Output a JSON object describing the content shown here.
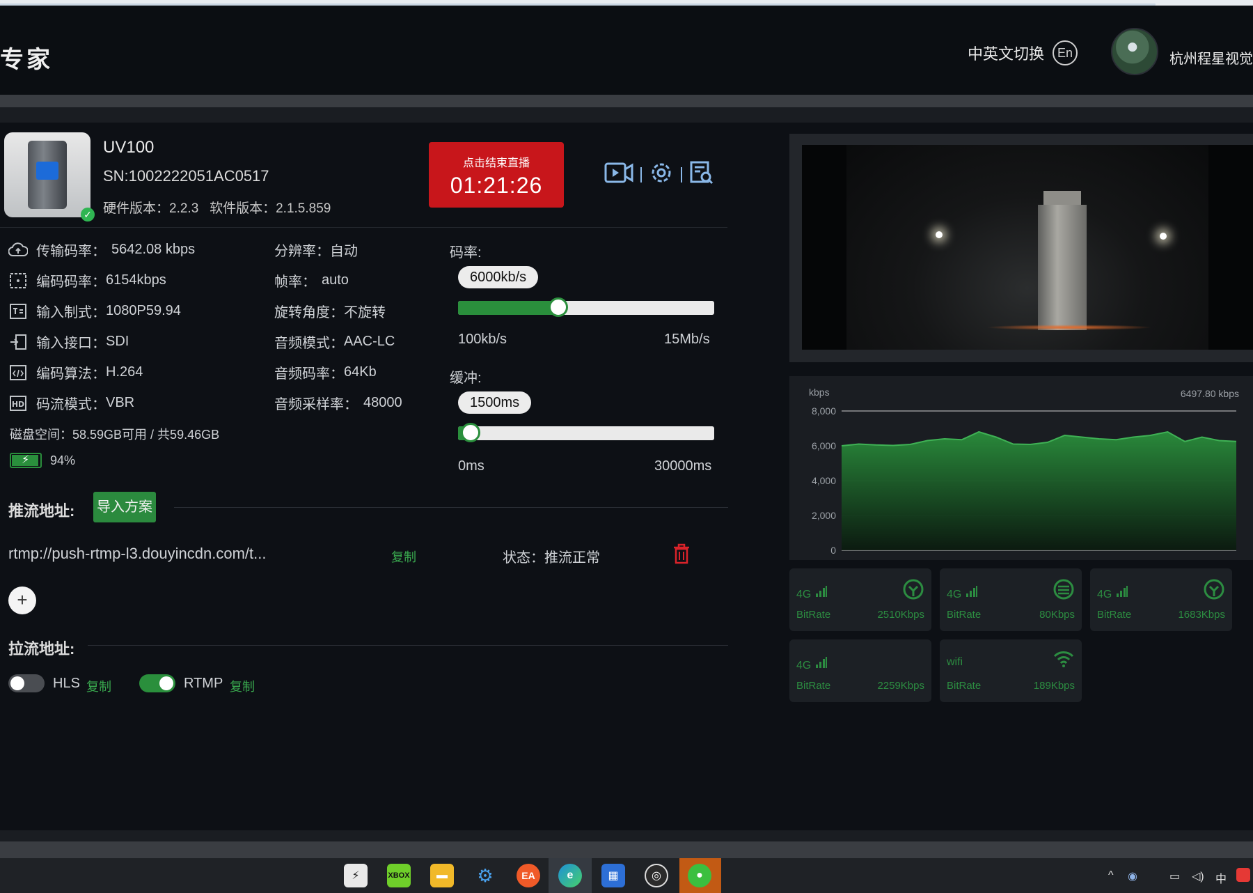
{
  "header": {
    "app_title": "专家",
    "lang_switch_label": "中英文切换",
    "lang_icon_text": "En",
    "company": "杭州程星视觉"
  },
  "device": {
    "name": "UV100",
    "sn": "SN:1002222051AC0517",
    "versions": "硬件版本：2.2.3   软件版本：2.1.5.859",
    "live_button_label": "点击结束直播",
    "live_timer": "01:21:26"
  },
  "info": {
    "col1": [
      {
        "icon": "cloud-upload-icon",
        "label": "传输码率：",
        "value": "5642.08 kbps"
      },
      {
        "icon": "encode-bitrate-icon",
        "label": "编码码率：",
        "value": "6154kbps"
      },
      {
        "icon": "input-format-icon",
        "label": "输入制式：",
        "value": "1080P59.94"
      },
      {
        "icon": "input-port-icon",
        "label": "输入接口：",
        "value": "SDI"
      },
      {
        "icon": "codec-icon",
        "label": "编码算法：",
        "value": "H.264"
      },
      {
        "icon": "hd-icon",
        "label": "码流模式：",
        "value": "VBR"
      }
    ],
    "col2": [
      {
        "label": "分辨率：",
        "value": "自动"
      },
      {
        "label": "帧率：",
        "value": "auto"
      },
      {
        "label": "旋转角度：",
        "value": "不旋转"
      },
      {
        "label": "音频模式：",
        "value": "AAC-LC"
      },
      {
        "label": "音频码率：",
        "value": "64Kb"
      },
      {
        "label": "音频采样率：",
        "value": "48000"
      }
    ],
    "disk": "磁盘空间：58.59GB可用 / 共59.46GB",
    "battery": "94%",
    "battery_level": 0.94
  },
  "bitrate_slider": {
    "label": "码率:",
    "value_label": "6000kb/s",
    "min_label": "100kb/s",
    "max_label": "15Mb/s",
    "fraction": 0.39
  },
  "buffer_slider": {
    "label": "缓冲:",
    "value_label": "1500ms",
    "min_label": "0ms",
    "max_label": "30000ms",
    "fraction": 0.05
  },
  "push": {
    "title": "推流地址:",
    "import_label": "导入方案",
    "url": "rtmp://push-rtmp-l3.douyincdn.com/t...",
    "copy_label": "复制",
    "status_label": "状态：推流正常",
    "add_label": "+"
  },
  "pull": {
    "title": "拉流地址:",
    "hls_label": "HLS",
    "hls_copy": "复制",
    "hls_on": false,
    "rtmp_label": "RTMP",
    "rtmp_copy": "复制",
    "rtmp_on": true
  },
  "chart_data": {
    "type": "area",
    "ylabel": "kbps",
    "current_value_label": "6497.80 kbps",
    "ylim": [
      0,
      8000
    ],
    "yticks": [
      "8,000",
      "6,000",
      "4,000",
      "2,000",
      "0"
    ],
    "ytick_values": [
      8000,
      6000,
      4000,
      2000,
      0
    ],
    "grid": true,
    "values": [
      6000,
      6100,
      6050,
      6020,
      6080,
      6300,
      6400,
      6350,
      6800,
      6500,
      6100,
      6080,
      6200,
      6600,
      6500,
      6400,
      6350,
      6500,
      6600,
      6800,
      6250,
      6500,
      6300,
      6250
    ],
    "color": "#2a8f3c"
  },
  "links": [
    {
      "net": "4G",
      "signal_icon": "signal-bars-icon",
      "link_icon": "link-status-icon",
      "label": "BitRate",
      "value": "2510Kbps"
    },
    {
      "net": "4G",
      "signal_icon": "signal-bars-icon",
      "link_icon": "link-status-icon",
      "label": "BitRate",
      "value": "80Kbps"
    },
    {
      "net": "4G",
      "signal_icon": "signal-bars-icon",
      "link_icon": "link-status-icon",
      "label": "BitRate",
      "value": "1683Kbps"
    },
    {
      "net": "4G",
      "signal_icon": "signal-bars-icon",
      "link_icon": "",
      "label": "BitRate",
      "value": "2259Kbps"
    },
    {
      "net": "wifi",
      "signal_icon": "",
      "link_icon": "wifi-icon",
      "label": "BitRate",
      "value": "189Kbps"
    }
  ],
  "taskbar": {
    "ime": "中",
    "apps": [
      "bolt-app-icon",
      "xbox-app-icon",
      "file-explorer-icon",
      "settings-app-icon",
      "ea-app-icon",
      "edge-browser-icon",
      "store-app-icon",
      "obs-app-icon",
      "wechat-app-icon"
    ]
  },
  "colors": {
    "accent_green": "#2a8f3c",
    "live_red": "#c8161b",
    "icon_blue": "#8ab8e8"
  }
}
